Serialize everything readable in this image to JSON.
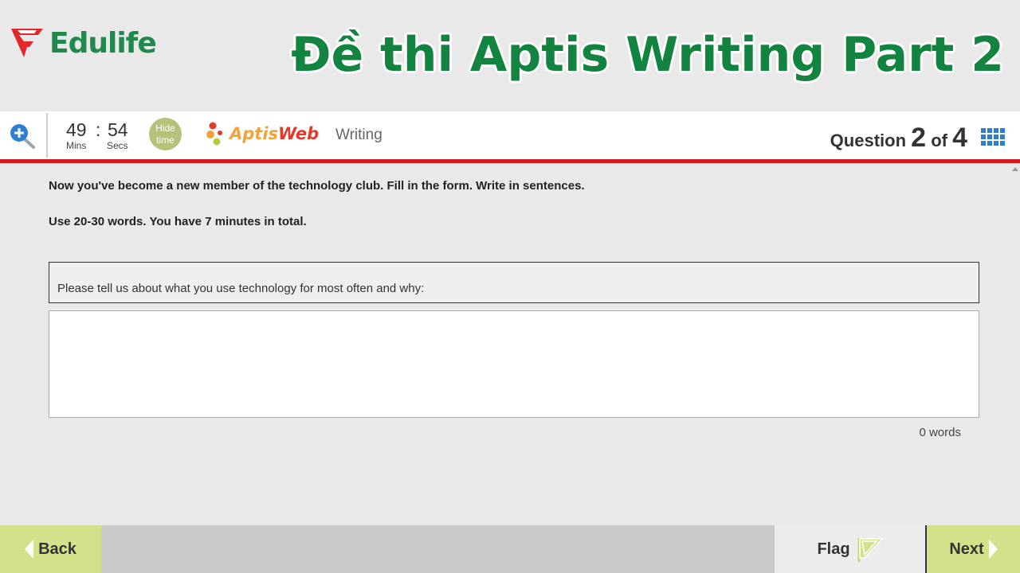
{
  "banner": {
    "brand": "Edulife",
    "title": "Đề thi Aptis Writing Part 2"
  },
  "header": {
    "timer": {
      "mins": "49",
      "colon": ":",
      "secs": "54",
      "mins_label": "Mins",
      "secs_label": "Secs"
    },
    "hide_time_label": "Hide time",
    "product": {
      "part1": "Aptis",
      "part2": "Web"
    },
    "section": "Writing",
    "question": {
      "prefix": "Question",
      "current": "2",
      "of": "of",
      "total": "4"
    }
  },
  "content": {
    "instruction_1": "Now you've become a new member of the technology club. Fill in the form. Write in sentences.",
    "instruction_2": "Use 20-30 words. You have 7 minutes in total.",
    "prompt": "Please tell us about what you use technology for most often and why:",
    "answer_value": "",
    "word_count": "0 words"
  },
  "footer": {
    "back_label": "Back",
    "flag_label": "Flag",
    "next_label": "Next"
  },
  "colors": {
    "brand_green": "#1f8a4c",
    "accent_red": "#d21f26",
    "button_green": "#d3e28a",
    "grid_blue": "#2d7fd3"
  }
}
